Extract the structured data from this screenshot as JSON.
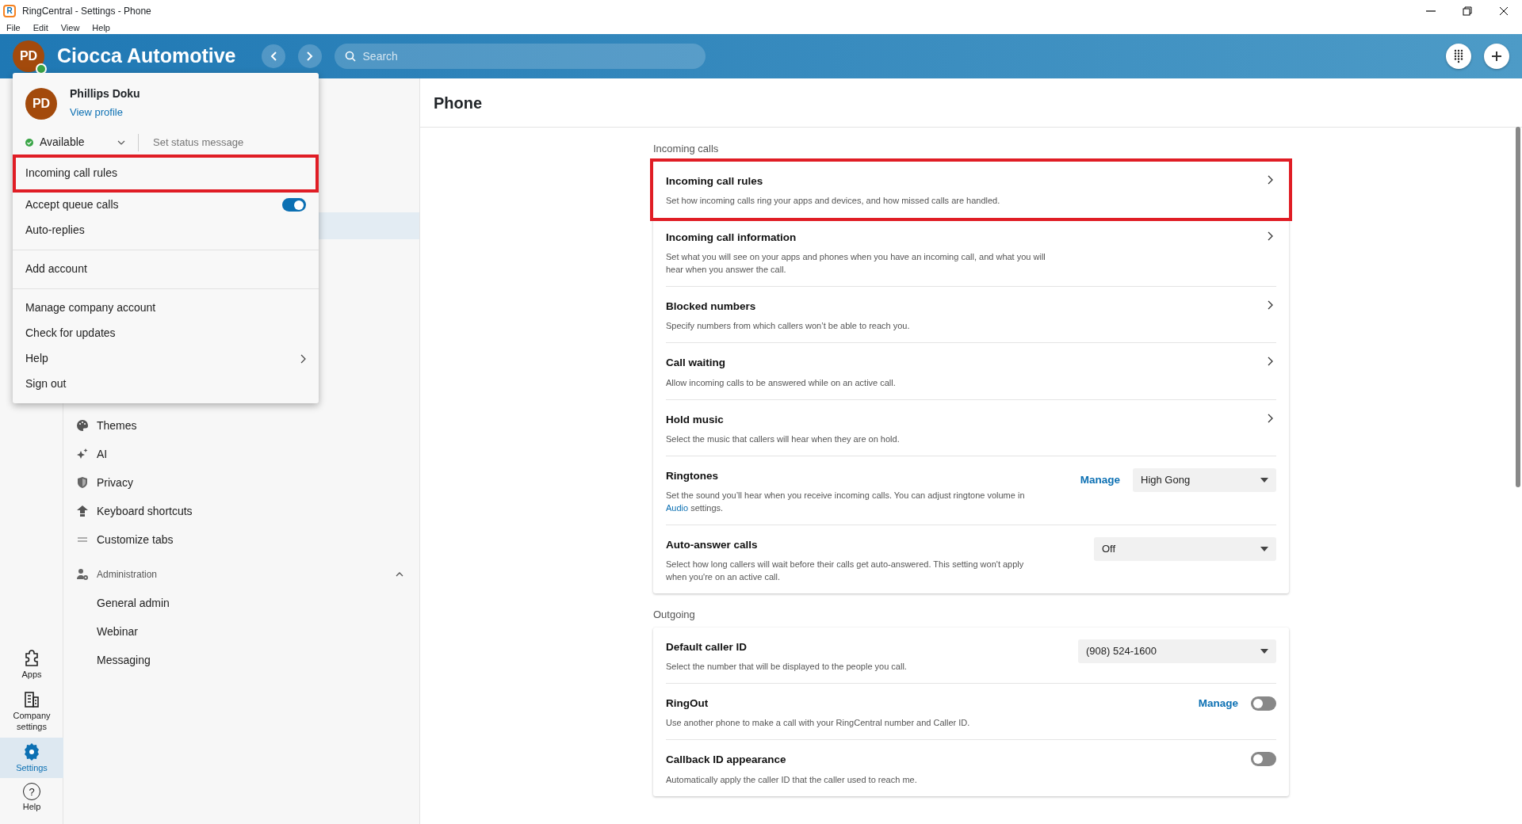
{
  "window": {
    "logo_letter": "R",
    "title": "RingCentral - Settings - Phone"
  },
  "menu_bar": [
    "File",
    "Edit",
    "View",
    "Help"
  ],
  "header": {
    "avatar_initials": "PD",
    "online": true,
    "company": "Ciocca Automotive",
    "search_placeholder": "Search"
  },
  "profile_menu": {
    "initials": "PD",
    "name": "Phillips Doku",
    "profile_link": "View profile",
    "status": "Available",
    "status_placeholder": "Set status message",
    "groups": [
      [
        {
          "label": "Incoming call rules",
          "kind": "item",
          "highlighted": true
        },
        {
          "label": "Accept queue calls",
          "kind": "toggle",
          "on": true,
          "highlighted": false
        },
        {
          "label": "Auto-replies",
          "kind": "item",
          "highlighted": false
        }
      ],
      [
        {
          "label": "Add account",
          "kind": "item",
          "highlighted": false
        }
      ],
      [
        {
          "label": "Manage company account",
          "kind": "item",
          "highlighted": false
        },
        {
          "label": "Check for updates",
          "kind": "item",
          "highlighted": false
        },
        {
          "label": "Help",
          "kind": "submenu",
          "highlighted": false
        },
        {
          "label": "Sign out",
          "kind": "item",
          "highlighted": false
        }
      ]
    ]
  },
  "sidebar": {
    "items": [
      {
        "label": "Themes"
      },
      {
        "label": "AI"
      },
      {
        "label": "Privacy"
      },
      {
        "label": "Keyboard shortcuts"
      },
      {
        "label": "Customize tabs"
      }
    ],
    "administration": {
      "label": "Administration",
      "expanded": true,
      "children": [
        {
          "label": "General admin"
        },
        {
          "label": "Webinar"
        },
        {
          "label": "Messaging"
        }
      ]
    }
  },
  "rail": [
    {
      "label": "Apps",
      "selected": false
    },
    {
      "label": "Company settings",
      "selected": false
    },
    {
      "label": "Settings",
      "selected": true
    },
    {
      "label": "Help",
      "icon_glyph": "?",
      "selected": false
    }
  ],
  "page": {
    "title": "Phone",
    "sections": [
      {
        "label": "Incoming calls",
        "rows": [
          {
            "kind": "link",
            "title": "Incoming call rules",
            "description": "Set how incoming calls ring your apps and devices, and how missed calls are handled.",
            "highlighted": true
          },
          {
            "kind": "link",
            "title": "Incoming call information",
            "description": "Set what you will see on your apps and phones when you have an incoming call, and what you will hear when you answer the call.",
            "highlighted": false
          },
          {
            "kind": "link",
            "title": "Blocked numbers",
            "description": "Specify numbers from which callers won’t be able to reach you.",
            "highlighted": false
          },
          {
            "kind": "link",
            "title": "Call waiting",
            "description": "Allow incoming calls to be answered while on an active call.",
            "highlighted": false
          },
          {
            "kind": "link",
            "title": "Hold music",
            "description": "Select the music that callers will hear when they are on hold.",
            "highlighted": false
          },
          {
            "kind": "select",
            "title": "Ringtones",
            "description": "Set the sound you’ll hear when you receive incoming calls. You can adjust ringtone volume in",
            "description_link": "Audio",
            "description_after": "settings.",
            "manage": "Manage",
            "value": "High Gong",
            "highlighted": false
          },
          {
            "kind": "select",
            "title": "Auto-answer calls",
            "description": "Select how long callers will wait before their calls get auto-answered. This setting won't apply when you're on an active call.",
            "value": "Off",
            "highlighted": false
          }
        ]
      },
      {
        "label": "Outgoing",
        "rows": [
          {
            "kind": "select",
            "title": "Default caller ID",
            "description": "Select the number that will be displayed to the people you call.",
            "value": "(908) 524-1600",
            "highlighted": false
          },
          {
            "kind": "toggle",
            "title": "RingOut",
            "description": "Use another phone to make a call with your RingCentral number and Caller ID.",
            "manage": "Manage",
            "on": false,
            "highlighted": false
          },
          {
            "kind": "toggle",
            "title": "Callback ID appearance",
            "description": "Automatically apply the caller ID that the caller used to reach me.",
            "on": false,
            "highlighted": false
          }
        ]
      }
    ]
  }
}
